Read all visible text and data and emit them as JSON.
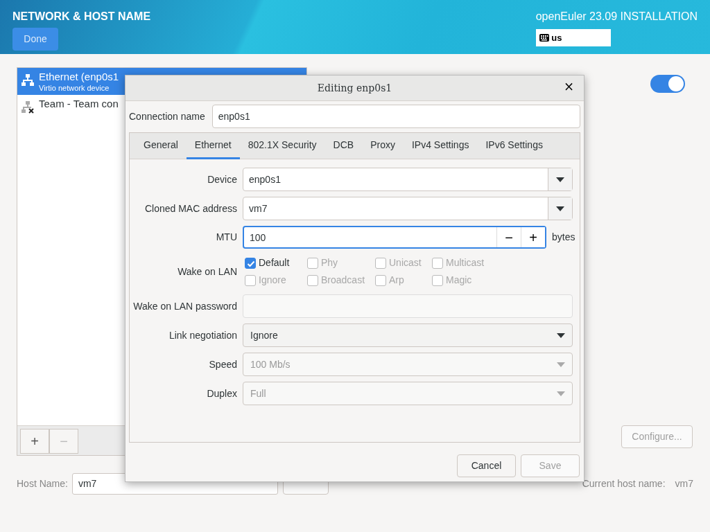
{
  "header": {
    "title": "NETWORK & HOST NAME",
    "done_button": "Done",
    "product": "openEuler 23.09 INSTALLATION",
    "keyboard_layout": "us"
  },
  "devices": [
    {
      "kind": "ethernet",
      "name": "Ethernet (enp0s1",
      "description": "Virtio network device",
      "selected": true
    },
    {
      "kind": "team",
      "name": "Team - Team con",
      "selected": false
    }
  ],
  "list_buttons": [
    {
      "label": "+",
      "disabled": false
    },
    {
      "label": "−",
      "disabled": true
    }
  ],
  "device_switch": {
    "on": true
  },
  "configure_button": {
    "label": "Configure...",
    "disabled": true
  },
  "host_name": {
    "label": "Host Name:",
    "value": "vm7",
    "current_label": "Current host name:",
    "current_value": "vm7"
  },
  "dialog": {
    "title": "Editing enp0s1",
    "close": "×",
    "connection_name_label": "Connection name",
    "connection_name": "enp0s1",
    "tabs": [
      {
        "label": "General",
        "selected": false
      },
      {
        "label": "Ethernet",
        "selected": true
      },
      {
        "label": "802.1X Security",
        "selected": false
      },
      {
        "label": "DCB",
        "selected": false
      },
      {
        "label": "Proxy",
        "selected": false
      },
      {
        "label": "IPv4 Settings",
        "selected": false
      },
      {
        "label": "IPv6 Settings",
        "selected": false
      }
    ],
    "fields": [
      {
        "kind": "combo",
        "label": "Device",
        "value": "enp0s1"
      },
      {
        "kind": "combo",
        "label": "Cloned MAC address",
        "value": "vm7"
      },
      {
        "kind": "spin",
        "label": "MTU",
        "value": "100",
        "unit": "bytes",
        "minus": "−",
        "plus": "+"
      },
      {
        "kind": "checks",
        "label": "Wake on LAN",
        "options": [
          {
            "label": "Default",
            "checked": true,
            "disabled": false
          },
          {
            "label": "Phy",
            "checked": false,
            "disabled": true
          },
          {
            "label": "Unicast",
            "checked": false,
            "disabled": true
          },
          {
            "label": "Multicast",
            "checked": false,
            "disabled": true
          },
          {
            "label": "Ignore",
            "checked": false,
            "disabled": true
          },
          {
            "label": "Broadcast",
            "checked": false,
            "disabled": true
          },
          {
            "label": "Arp",
            "checked": false,
            "disabled": true
          },
          {
            "label": "Magic",
            "checked": false,
            "disabled": true
          }
        ]
      },
      {
        "kind": "entry",
        "label": "Wake on LAN password"
      },
      {
        "kind": "select",
        "label": "Link negotiation",
        "value": "Ignore",
        "disabled": false
      },
      {
        "kind": "select",
        "label": "Speed",
        "value": "100 Mb/s",
        "disabled": true
      },
      {
        "kind": "select",
        "label": "Duplex",
        "value": "Full",
        "disabled": true
      }
    ],
    "buttons": [
      {
        "label": "Cancel",
        "disabled": false
      },
      {
        "label": "Save",
        "disabled": true
      }
    ]
  }
}
